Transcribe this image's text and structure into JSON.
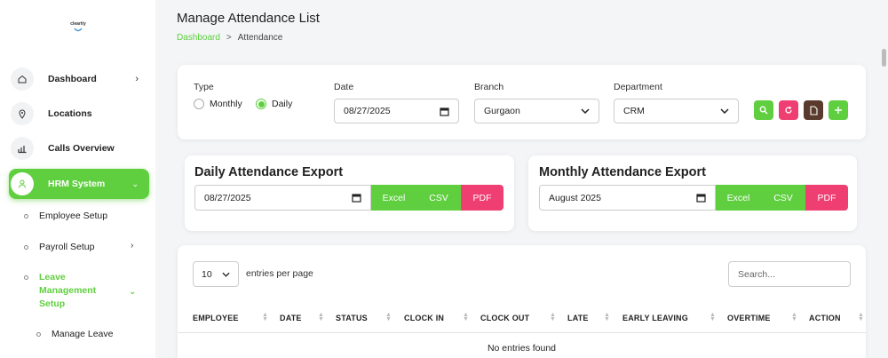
{
  "brand": {
    "logo_text": "clearity"
  },
  "sidebar": {
    "items": [
      {
        "label": "Dashboard",
        "icon": "home-icon"
      },
      {
        "label": "Locations",
        "icon": "location-pin-icon"
      },
      {
        "label": "Calls Overview",
        "icon": "bar-chart-icon"
      },
      {
        "label": "HRM System",
        "icon": "user-icon"
      }
    ],
    "sub": {
      "employee_setup": "Employee Setup",
      "payroll_setup": "Payroll Setup",
      "leave_management_line1": "Leave",
      "leave_management_line2": "Management",
      "leave_management_line3": "Setup",
      "manage_leave": "Manage Leave"
    }
  },
  "header": {
    "title": "Manage Attendance List",
    "breadcrumb": {
      "home": "Dashboard",
      "separator": ">",
      "current": "Attendance"
    }
  },
  "filter": {
    "type_label": "Type",
    "type_options": [
      "Monthly",
      "Daily"
    ],
    "type_selected": "Daily",
    "date_label": "Date",
    "date_value": "08/27/2025",
    "branch_label": "Branch",
    "branch_value": "Gurgaon",
    "department_label": "Department",
    "department_value": "CRM"
  },
  "daily_export": {
    "title": "Daily Attendance Export",
    "date_value": "08/27/2025",
    "excel": "Excel",
    "csv": "CSV",
    "pdf": "PDF"
  },
  "monthly_export": {
    "title": "Monthly Attendance Export",
    "month_value": "August 2025",
    "excel": "Excel",
    "csv": "CSV",
    "pdf": "PDF"
  },
  "table": {
    "page_size": "10",
    "entries_label": "entries per page",
    "search_placeholder": "Search...",
    "columns": [
      "EMPLOYEE",
      "DATE",
      "STATUS",
      "CLOCK IN",
      "CLOCK OUT",
      "LATE",
      "EARLY LEAVING",
      "OVERTIME",
      "ACTION"
    ],
    "empty": "No entries found"
  },
  "colors": {
    "accent": "#5fcf3f",
    "pink": "#ef3f72",
    "brown": "#5a3a2c"
  }
}
